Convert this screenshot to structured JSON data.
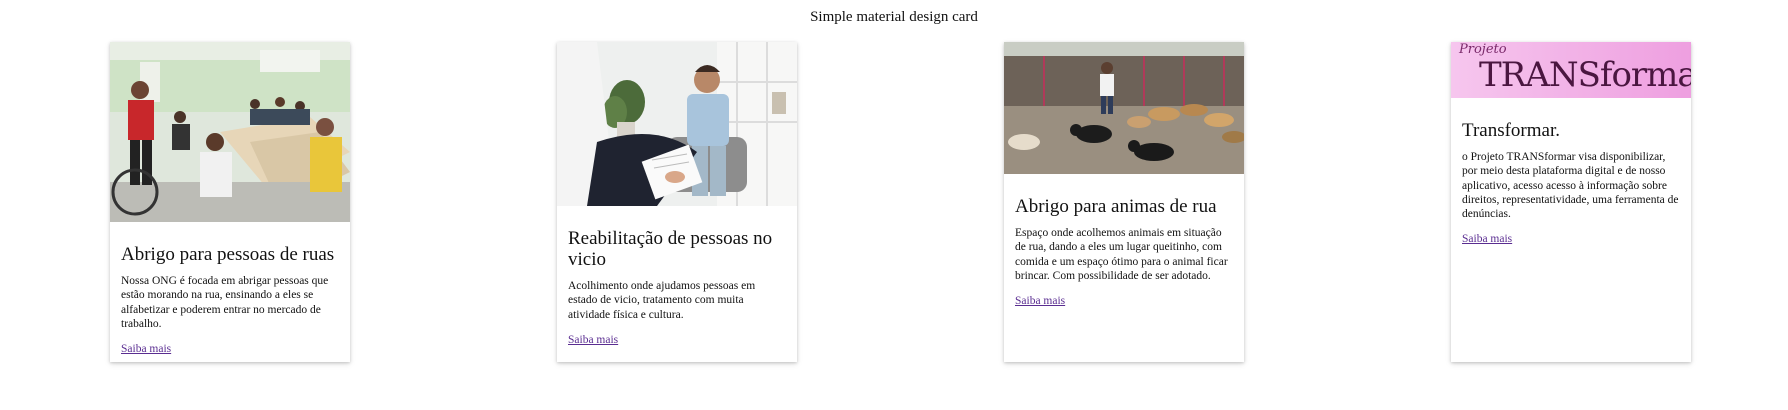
{
  "page": {
    "title": "Simple material design card"
  },
  "cards": [
    {
      "title": "Abrigo para pessoas de ruas",
      "text": "Nossa ONG é focada em abrigar pessoas que estão morando na rua, ensinando a eles se alfabetizar e poderem entrar no mercado de trabalho.",
      "link": "Saiba mais"
    },
    {
      "title": "Reabilitação de pessoas no vicio",
      "text": "Acolhimento onde ajudamos pessoas em estado de vicio, tratamento com muita atividade física e cultura.",
      "link": "Saiba mais"
    },
    {
      "title": "Abrigo para animas de rua",
      "text": "Espaço onde acolhemos animais em situação de rua, dando a eles um lugar queitinho, com comida e um espaço ótimo para o animal ficar brincar. Com possibilidade de ser adotado.",
      "link": "Saiba mais"
    },
    {
      "title": "Transformar.",
      "text": "o Projeto TRANSformar visa disponibilizar, por meio desta plataforma digital e de nosso aplicativo, acesso acesso à informação sobre direitos, representatividade, uma ferramenta de denúncias.",
      "link": "Saiba mais",
      "banner_small": "Projeto",
      "banner_large": "TRANSformar"
    }
  ],
  "colors": {
    "link": "#5a2d91",
    "banner_pink": "#f2b8e6",
    "banner_text": "#5a1a4a"
  }
}
